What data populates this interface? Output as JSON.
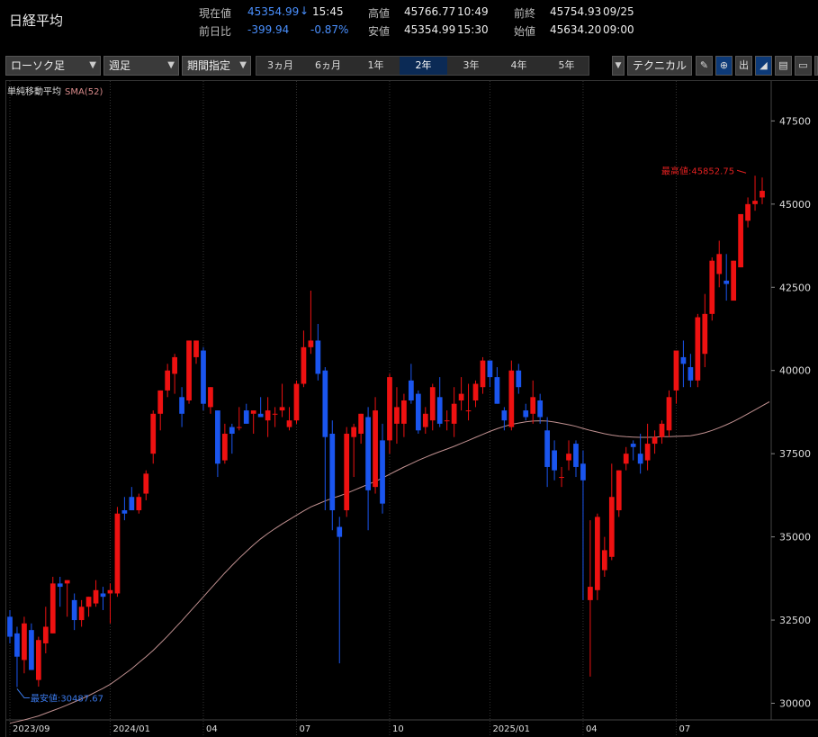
{
  "header": {
    "title": "日経平均",
    "current_label": "現在値",
    "current_value": "45354.99",
    "current_arrow": "↓",
    "current_time": "15:45",
    "change_label": "前日比",
    "change_value": "-399.94",
    "change_pct": "-0.87%",
    "high_label": "高値",
    "high_value": "45766.77",
    "high_time": "10:49",
    "low_label": "安値",
    "low_value": "45354.99",
    "low_time": "15:30",
    "prev_label": "前終",
    "prev_value": "45754.93",
    "prev_date": "09/25",
    "open_label": "始値",
    "open_value": "45634.20",
    "open_time": "09:00"
  },
  "toolbar": {
    "chart_type": "ローソク足",
    "period": "週足",
    "range_mode": "期間指定",
    "ranges": [
      "3ヵ月",
      "6ヵ月",
      "1年",
      "2年",
      "3年",
      "4年",
      "5年"
    ],
    "active_range": "2年",
    "technical": "テクニカル",
    "icons": [
      "pencil-icon",
      "zoom-icon",
      "volume-icon",
      "area-chart-icon",
      "save-icon",
      "folder-icon",
      "export-icon"
    ],
    "volume_label": "出"
  },
  "legend": {
    "label": "単純移動平均",
    "sma": "SMA(52)"
  },
  "colors": {
    "up": "#ee1111",
    "down": "#1a55ee",
    "sma": "#c09090",
    "grid": "#2c2c2c",
    "high_annotation": "#e02020",
    "low_annotation": "#3a78e8"
  },
  "chart_data": {
    "type": "candlestick",
    "ylim": [
      29500,
      48700
    ],
    "yticks": [
      30000,
      32500,
      35000,
      37500,
      40000,
      42500,
      45000,
      47500
    ],
    "ytick_labels": [
      "30000",
      "32500",
      "35000",
      "37500",
      "40000",
      "42500",
      "45000",
      "47500"
    ],
    "xlabels": [
      {
        "label": "2023/09",
        "index": 0
      },
      {
        "label": "2024/01",
        "index": 14
      },
      {
        "label": "04",
        "index": 27
      },
      {
        "label": "07",
        "index": 40
      },
      {
        "label": "10",
        "index": 53
      },
      {
        "label": "2025/01",
        "index": 67
      },
      {
        "label": "04",
        "index": 80
      },
      {
        "label": "07",
        "index": 93
      }
    ],
    "high_annotation": "最高値:45852.75",
    "low_annotation": "最安値:30487.67",
    "high_point": {
      "index": 103,
      "value": 45852.75
    },
    "low_point": {
      "index": 1,
      "value": 30487.67
    },
    "candles": [
      {
        "o": 32600,
        "h": 32800,
        "l": 31800,
        "c": 32000
      },
      {
        "o": 32100,
        "h": 32300,
        "l": 30487.67,
        "c": 31400
      },
      {
        "o": 31300,
        "h": 32600,
        "l": 30900,
        "c": 32400
      },
      {
        "o": 32200,
        "h": 32400,
        "l": 31000,
        "c": 31000
      },
      {
        "o": 30700,
        "h": 32000,
        "l": 30500,
        "c": 31900
      },
      {
        "o": 31800,
        "h": 32900,
        "l": 31500,
        "c": 32300
      },
      {
        "o": 32100,
        "h": 33800,
        "l": 32100,
        "c": 33600
      },
      {
        "o": 33600,
        "h": 33800,
        "l": 32900,
        "c": 33500
      },
      {
        "o": 33600,
        "h": 33700,
        "l": 32600,
        "c": 33700
      },
      {
        "o": 33100,
        "h": 33300,
        "l": 32200,
        "c": 32500
      },
      {
        "o": 32500,
        "h": 33100,
        "l": 32300,
        "c": 32900
      },
      {
        "o": 32900,
        "h": 33200,
        "l": 32600,
        "c": 33200
      },
      {
        "o": 33000,
        "h": 33700,
        "l": 32900,
        "c": 33400
      },
      {
        "o": 33300,
        "h": 33500,
        "l": 32800,
        "c": 33200
      },
      {
        "o": 33300,
        "h": 33600,
        "l": 32400,
        "c": 33400
      },
      {
        "o": 33300,
        "h": 35900,
        "l": 33200,
        "c": 35700
      },
      {
        "o": 35800,
        "h": 36200,
        "l": 35500,
        "c": 35700
      },
      {
        "o": 36200,
        "h": 36500,
        "l": 35800,
        "c": 35800
      },
      {
        "o": 35800,
        "h": 36300,
        "l": 35700,
        "c": 36200
      },
      {
        "o": 36300,
        "h": 37000,
        "l": 36100,
        "c": 36900
      },
      {
        "o": 37500,
        "h": 38800,
        "l": 37200,
        "c": 38700
      },
      {
        "o": 38700,
        "h": 39400,
        "l": 38200,
        "c": 39400
      },
      {
        "o": 39400,
        "h": 40200,
        "l": 39200,
        "c": 40000
      },
      {
        "o": 39900,
        "h": 40500,
        "l": 39300,
        "c": 40400
      },
      {
        "o": 39200,
        "h": 39500,
        "l": 38300,
        "c": 38700
      },
      {
        "o": 39100,
        "h": 40900,
        "l": 39000,
        "c": 40900
      },
      {
        "o": 40400,
        "h": 40900,
        "l": 40200,
        "c": 40900
      },
      {
        "o": 40600,
        "h": 40700,
        "l": 38800,
        "c": 39000
      },
      {
        "o": 38900,
        "h": 39500,
        "l": 38700,
        "c": 39500
      },
      {
        "o": 38800,
        "h": 38800,
        "l": 36800,
        "c": 37200
      },
      {
        "o": 37300,
        "h": 38400,
        "l": 37200,
        "c": 38100
      },
      {
        "o": 38300,
        "h": 38400,
        "l": 37500,
        "c": 38100
      },
      {
        "o": 38300,
        "h": 38900,
        "l": 38200,
        "c": 38300
      },
      {
        "o": 38800,
        "h": 39000,
        "l": 38400,
        "c": 38400
      },
      {
        "o": 38700,
        "h": 38700,
        "l": 38100,
        "c": 38800
      },
      {
        "o": 38700,
        "h": 39200,
        "l": 38600,
        "c": 38600
      },
      {
        "o": 38500,
        "h": 39200,
        "l": 38000,
        "c": 38800
      },
      {
        "o": 38700,
        "h": 38900,
        "l": 38300,
        "c": 38700
      },
      {
        "o": 38800,
        "h": 39600,
        "l": 38600,
        "c": 38900
      },
      {
        "o": 38300,
        "h": 38900,
        "l": 38200,
        "c": 38500
      },
      {
        "o": 38500,
        "h": 39700,
        "l": 38400,
        "c": 39600
      },
      {
        "o": 39600,
        "h": 41200,
        "l": 39500,
        "c": 40700
      },
      {
        "o": 40700,
        "h": 42400,
        "l": 40500,
        "c": 40900
      },
      {
        "o": 40900,
        "h": 41400,
        "l": 39700,
        "c": 39900
      },
      {
        "o": 40000,
        "h": 40100,
        "l": 35800,
        "c": 38000
      },
      {
        "o": 38100,
        "h": 38500,
        "l": 35200,
        "c": 35800
      },
      {
        "o": 35300,
        "h": 35600,
        "l": 31200,
        "c": 35000
      },
      {
        "o": 35800,
        "h": 38300,
        "l": 35600,
        "c": 38100
      },
      {
        "o": 38000,
        "h": 38400,
        "l": 36800,
        "c": 38300
      },
      {
        "o": 38100,
        "h": 38700,
        "l": 37800,
        "c": 38700
      },
      {
        "o": 38600,
        "h": 38900,
        "l": 35200,
        "c": 36400
      },
      {
        "o": 36500,
        "h": 39200,
        "l": 36300,
        "c": 38800
      },
      {
        "o": 37900,
        "h": 38400,
        "l": 35700,
        "c": 36000
      },
      {
        "o": 37900,
        "h": 39900,
        "l": 37500,
        "c": 39800
      },
      {
        "o": 38400,
        "h": 39500,
        "l": 37800,
        "c": 38900
      },
      {
        "o": 38400,
        "h": 39300,
        "l": 38000,
        "c": 39100
      },
      {
        "o": 39700,
        "h": 40200,
        "l": 39000,
        "c": 39100
      },
      {
        "o": 39300,
        "h": 39400,
        "l": 38100,
        "c": 38200
      },
      {
        "o": 38300,
        "h": 38900,
        "l": 38100,
        "c": 38700
      },
      {
        "o": 38500,
        "h": 39600,
        "l": 38200,
        "c": 39500
      },
      {
        "o": 39200,
        "h": 39800,
        "l": 38300,
        "c": 38400
      },
      {
        "o": 38500,
        "h": 38800,
        "l": 38200,
        "c": 38500
      },
      {
        "o": 38400,
        "h": 39500,
        "l": 38000,
        "c": 39000
      },
      {
        "o": 39100,
        "h": 39800,
        "l": 38800,
        "c": 39300
      },
      {
        "o": 38800,
        "h": 39600,
        "l": 38500,
        "c": 38800
      },
      {
        "o": 39100,
        "h": 39700,
        "l": 38900,
        "c": 39600
      },
      {
        "o": 39500,
        "h": 40400,
        "l": 39300,
        "c": 40300
      },
      {
        "o": 40300,
        "h": 40300,
        "l": 39500,
        "c": 39800
      },
      {
        "o": 39800,
        "h": 40100,
        "l": 39000,
        "c": 39000
      },
      {
        "o": 38800,
        "h": 38900,
        "l": 38200,
        "c": 38500
      },
      {
        "o": 38300,
        "h": 40300,
        "l": 38200,
        "c": 40000
      },
      {
        "o": 40000,
        "h": 40200,
        "l": 39300,
        "c": 39500
      },
      {
        "o": 38800,
        "h": 39000,
        "l": 38500,
        "c": 38600
      },
      {
        "o": 38700,
        "h": 39700,
        "l": 38400,
        "c": 39200
      },
      {
        "o": 39100,
        "h": 39300,
        "l": 38400,
        "c": 38600
      },
      {
        "o": 38200,
        "h": 38600,
        "l": 36500,
        "c": 37100
      },
      {
        "o": 37600,
        "h": 37900,
        "l": 36700,
        "c": 37000
      },
      {
        "o": 36800,
        "h": 37100,
        "l": 36500,
        "c": 36800
      },
      {
        "o": 37300,
        "h": 37900,
        "l": 37000,
        "c": 37500
      },
      {
        "o": 37800,
        "h": 37900,
        "l": 36800,
        "c": 37100
      },
      {
        "o": 37200,
        "h": 37600,
        "l": 33100,
        "c": 36700
      },
      {
        "o": 33100,
        "h": 35500,
        "l": 30800,
        "c": 33500
      },
      {
        "o": 33400,
        "h": 35700,
        "l": 33100,
        "c": 35600
      },
      {
        "o": 34000,
        "h": 35000,
        "l": 33800,
        "c": 34600
      },
      {
        "o": 34400,
        "h": 37200,
        "l": 34300,
        "c": 36200
      },
      {
        "o": 35800,
        "h": 37000,
        "l": 35600,
        "c": 37000
      },
      {
        "o": 37200,
        "h": 37700,
        "l": 37000,
        "c": 37500
      },
      {
        "o": 37800,
        "h": 37900,
        "l": 37300,
        "c": 37700
      },
      {
        "o": 37500,
        "h": 38100,
        "l": 36900,
        "c": 37200
      },
      {
        "o": 37300,
        "h": 38400,
        "l": 37000,
        "c": 37800
      },
      {
        "o": 37800,
        "h": 38200,
        "l": 37500,
        "c": 38000
      },
      {
        "o": 38000,
        "h": 38500,
        "l": 37800,
        "c": 38400
      },
      {
        "o": 38200,
        "h": 39400,
        "l": 38000,
        "c": 39200
      },
      {
        "o": 39400,
        "h": 40100,
        "l": 39000,
        "c": 40600
      },
      {
        "o": 40400,
        "h": 40900,
        "l": 39500,
        "c": 40200
      },
      {
        "o": 40100,
        "h": 40500,
        "l": 39500,
        "c": 39700
      },
      {
        "o": 39700,
        "h": 41700,
        "l": 39500,
        "c": 41600
      },
      {
        "o": 40500,
        "h": 42300,
        "l": 40100,
        "c": 41700
      },
      {
        "o": 41700,
        "h": 43400,
        "l": 41500,
        "c": 43300
      },
      {
        "o": 42900,
        "h": 43900,
        "l": 42500,
        "c": 43500
      },
      {
        "o": 42700,
        "h": 43500,
        "l": 42100,
        "c": 42600
      },
      {
        "o": 42100,
        "h": 43300,
        "l": 42300,
        "c": 43300
      },
      {
        "o": 43100,
        "h": 44500,
        "l": 43100,
        "c": 44700
      },
      {
        "o": 44500,
        "h": 45200,
        "l": 44300,
        "c": 45000
      },
      {
        "o": 45000,
        "h": 45852.75,
        "l": 44800,
        "c": 45100
      },
      {
        "o": 45200,
        "h": 45800,
        "l": 45000,
        "c": 45400
      }
    ],
    "sma52": [
      29400,
      29450,
      29500,
      29560,
      29620,
      29700,
      29780,
      29860,
      29950,
      30040,
      30130,
      30230,
      30340,
      30450,
      30570,
      30720,
      30880,
      31040,
      31220,
      31400,
      31590,
      31800,
      32020,
      32250,
      32480,
      32720,
      32960,
      33200,
      33440,
      33680,
      33920,
      34140,
      34360,
      34560,
      34760,
      34940,
      35100,
      35250,
      35390,
      35520,
      35650,
      35780,
      35900,
      35990,
      36080,
      36160,
      36230,
      36310,
      36400,
      36490,
      36580,
      36670,
      36770,
      36880,
      36990,
      37100,
      37200,
      37300,
      37390,
      37480,
      37560,
      37640,
      37720,
      37810,
      37900,
      37990,
      38080,
      38170,
      38250,
      38320,
      38380,
      38420,
      38460,
      38480,
      38490,
      38480,
      38450,
      38410,
      38370,
      38320,
      38260,
      38200,
      38150,
      38100,
      38060,
      38030,
      38010,
      38000,
      37990,
      37990,
      38000,
      38010,
      38010,
      38020,
      38030,
      38040,
      38080,
      38130,
      38200,
      38280,
      38370,
      38470,
      38580,
      38700,
      38820,
      38940,
      39060
    ]
  }
}
